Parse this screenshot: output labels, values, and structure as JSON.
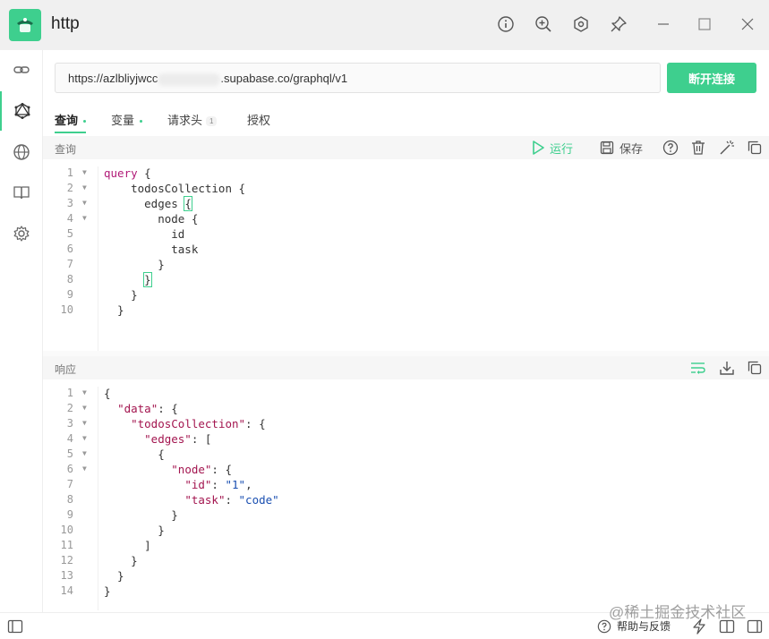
{
  "app": {
    "title": "http"
  },
  "connection": {
    "url_prefix": "https://azlbliyjwcc",
    "url_suffix": ".supabase.co/graphql/v1",
    "button_label": "断开连接"
  },
  "tabs": [
    {
      "label": "查询"
    },
    {
      "label": "变量"
    },
    {
      "label": "请求头",
      "count": "1"
    },
    {
      "label": "授权"
    }
  ],
  "query_section": {
    "label": "查询",
    "run_label": "运行",
    "save_label": "保存"
  },
  "response_section": {
    "label": "响应"
  },
  "query_lines": [
    {
      "n": "1"
    },
    {
      "n": "2"
    },
    {
      "n": "3"
    },
    {
      "n": "4"
    },
    {
      "n": "5"
    },
    {
      "n": "6"
    },
    {
      "n": "7"
    },
    {
      "n": "8"
    },
    {
      "n": "9"
    },
    {
      "n": "10"
    }
  ],
  "query_text": {
    "l1_kw": "query",
    "l1_rest": " {",
    "l2": "    todosCollection {",
    "l3a": "      edges ",
    "l3b": "{",
    "l4": "        node {",
    "l5": "          id",
    "l6": "          task",
    "l7": "        }",
    "l8a": "      ",
    "l8b": "}",
    "l9": "    }",
    "l10": "  }"
  },
  "response_text": {
    "r1": "{",
    "r2_pre": "  ",
    "r2_key": "\"data\"",
    "r2_post": ": {",
    "r3_pre": "    ",
    "r3_key": "\"todosCollection\"",
    "r3_post": ": {",
    "r4_pre": "      ",
    "r4_key": "\"edges\"",
    "r4_post": ": [",
    "r5": "        {",
    "r6_pre": "          ",
    "r6_key": "\"node\"",
    "r6_post": ": {",
    "r7_pre": "            ",
    "r7_key": "\"id\"",
    "r7_mid": ": ",
    "r7_val": "\"1\"",
    "r7_post": ",",
    "r8_pre": "            ",
    "r8_key": "\"task\"",
    "r8_mid": ": ",
    "r8_val": "\"code\"",
    "r9": "          }",
    "r10": "        }",
    "r11": "      ]",
    "r12": "    }",
    "r13": "  }",
    "r14": "}"
  },
  "footer": {
    "help_label": "帮助与反馈"
  },
  "watermark": "@稀土掘金技术社区",
  "colors": {
    "accent": "#3ecf8e"
  }
}
